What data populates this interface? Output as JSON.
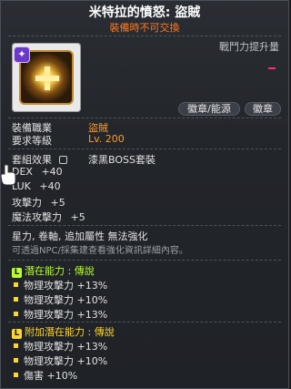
{
  "header": {
    "title": "米特拉的憤怒: 盜賊",
    "subtitle": "裝備時不可交換"
  },
  "item": {
    "power_label": "戰鬥力提升量",
    "buttons": [
      {
        "label": "徽章/能源"
      },
      {
        "label": "徽章"
      }
    ]
  },
  "requirements": {
    "job_label": "裝備職業",
    "job_value": "盜賊",
    "level_label": "要求等級",
    "level_value": "Lv. 200"
  },
  "set": {
    "label": "套組效果",
    "name": "漆黑BOSS套裝"
  },
  "stats": [
    {
      "name": "DEX",
      "value": "+40"
    },
    {
      "name": "LUK",
      "value": "+40"
    },
    {
      "name": "攻擊力",
      "value": "+5"
    },
    {
      "name": "魔法攻擊力",
      "value": "+5"
    }
  ],
  "enhance": {
    "line1": "星力, 卷軸, 追加屬性 無法強化",
    "line2": "可透過NPC/採集建查看強化資訊詳細內容。"
  },
  "potential": {
    "tag": "L",
    "title": "潛在能力 : 傳說",
    "lines": [
      "物理攻擊力 +13%",
      "物理攻擊力 +10%",
      "物理攻擊力 +13%"
    ]
  },
  "bonus_potential": {
    "tag": "L",
    "title": "附加潛在能力 : 傳說",
    "lines": [
      "物理攻擊力 +13%",
      "物理攻擊力 +10%",
      "傷害 +10%"
    ]
  },
  "colors": {
    "accent_orange": "#ff9a2a",
    "potential_green": "#b8ff2e",
    "bullet_yellow": "#ffd62e"
  }
}
